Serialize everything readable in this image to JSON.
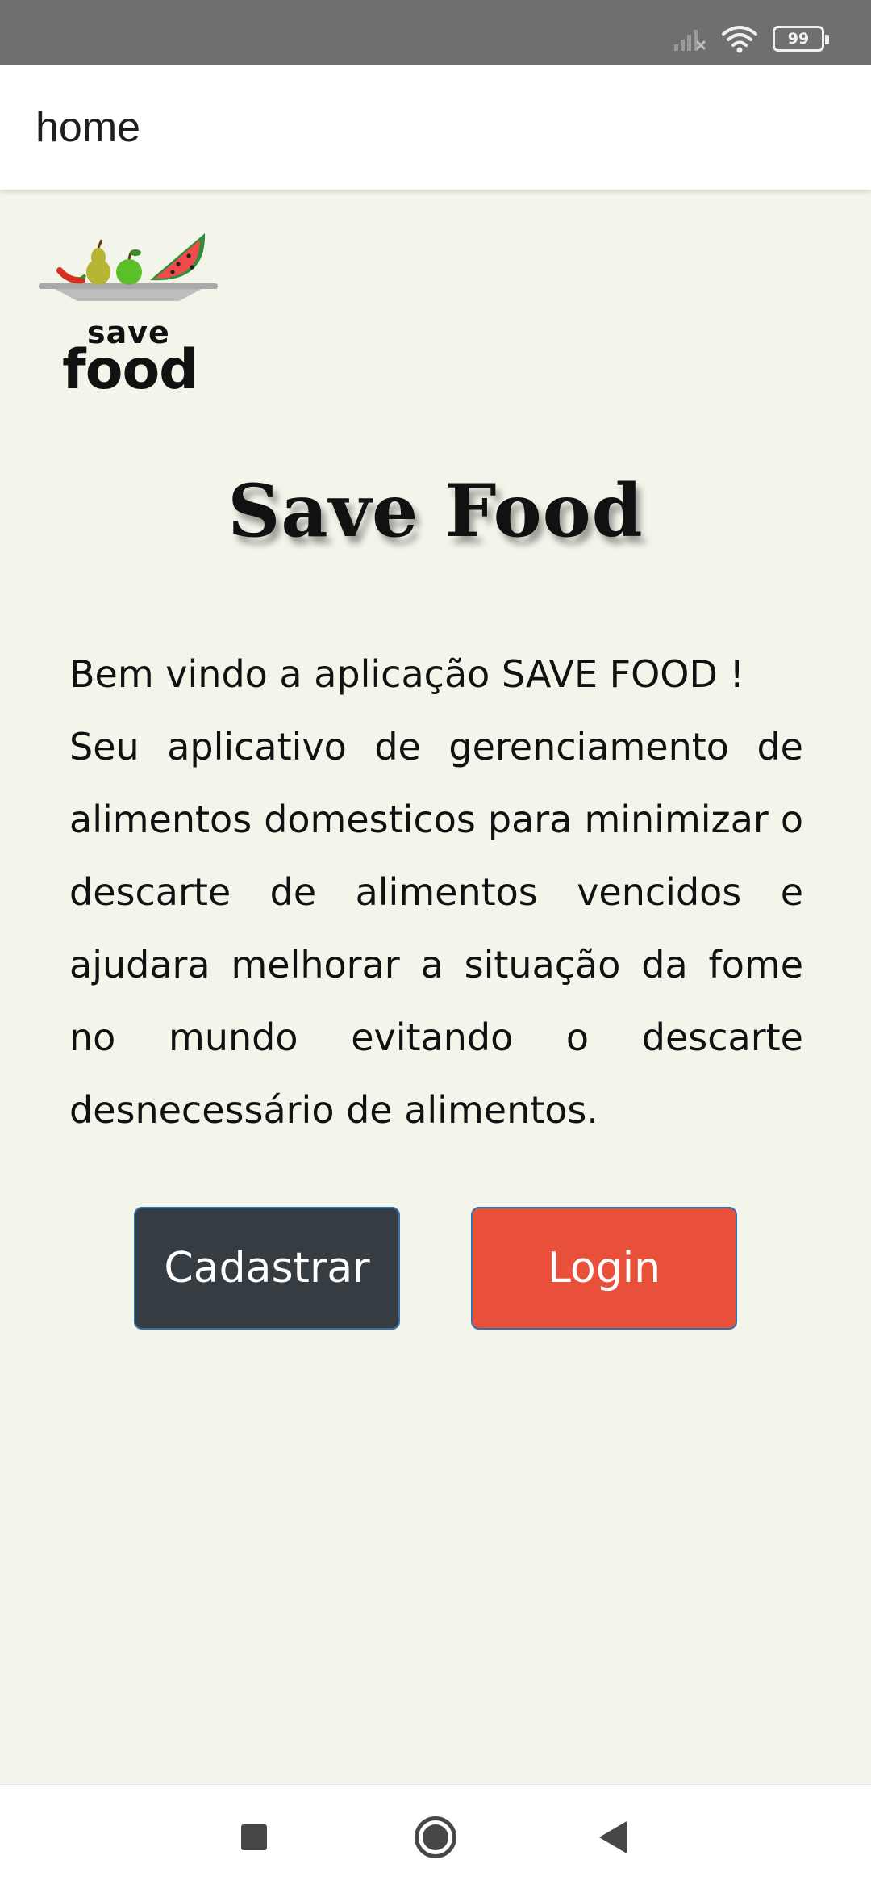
{
  "status_bar": {
    "battery_level": "99",
    "icons": [
      "signal-off-icon",
      "wifi-icon",
      "battery-icon"
    ]
  },
  "app_bar": {
    "title": "home"
  },
  "logo": {
    "line1": "save",
    "line2": "food"
  },
  "main": {
    "title": "Save Food",
    "welcome": "Bem vindo a aplicação SAVE FOOD !",
    "description": "Seu aplicativo de gerenciamento de alimentos domesticos para minimizar o descarte de alimentos vencidos e ajudara melhorar a situação da fome no mundo evitando o descarte desnecessário de alimentos."
  },
  "buttons": {
    "register_label": "Cadastrar",
    "login_label": "Login"
  },
  "colors": {
    "background": "#f3f4ea",
    "register_button": "#353c42",
    "login_button": "#e8503a",
    "status_bar": "#6f6f6f"
  },
  "nav_bar": {
    "icons": [
      "recents-square-icon",
      "home-circle-icon",
      "back-triangle-icon"
    ]
  }
}
